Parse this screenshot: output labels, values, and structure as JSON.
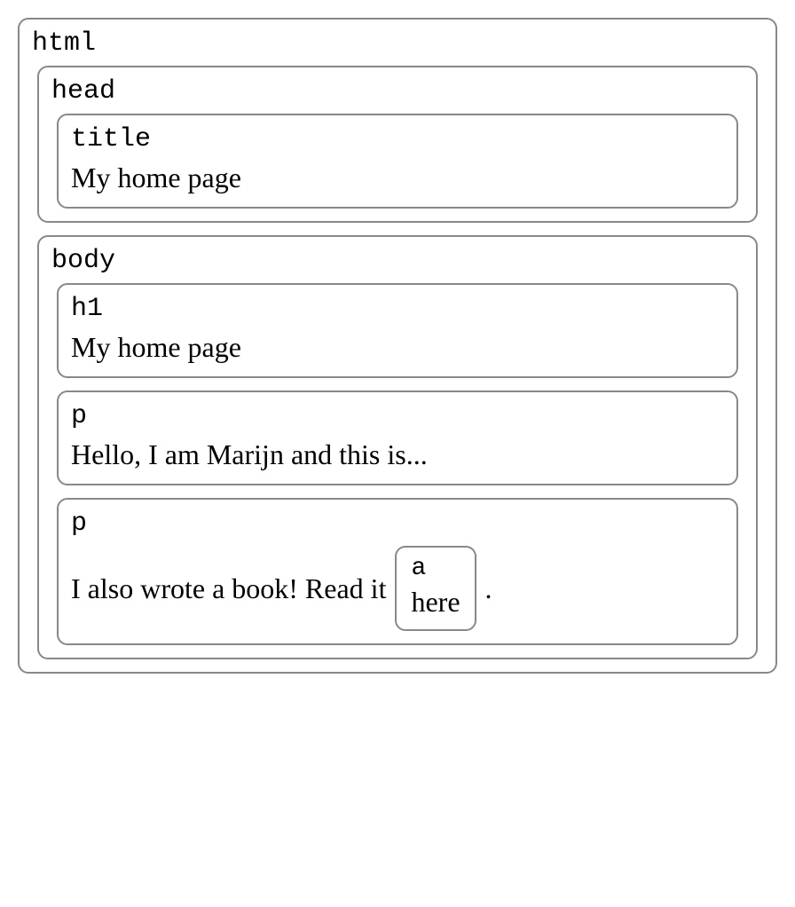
{
  "dom": {
    "html": {
      "tag": "html",
      "head": {
        "tag": "head",
        "title": {
          "tag": "title",
          "text": "My home page"
        }
      },
      "body": {
        "tag": "body",
        "h1": {
          "tag": "h1",
          "text": "My home page"
        },
        "p1": {
          "tag": "p",
          "text": "Hello, I am Marijn and this is..."
        },
        "p2": {
          "tag": "p",
          "text_before": "I also wrote a book! Read it",
          "a": {
            "tag": "a",
            "text": "here"
          },
          "text_after": "."
        }
      }
    }
  }
}
